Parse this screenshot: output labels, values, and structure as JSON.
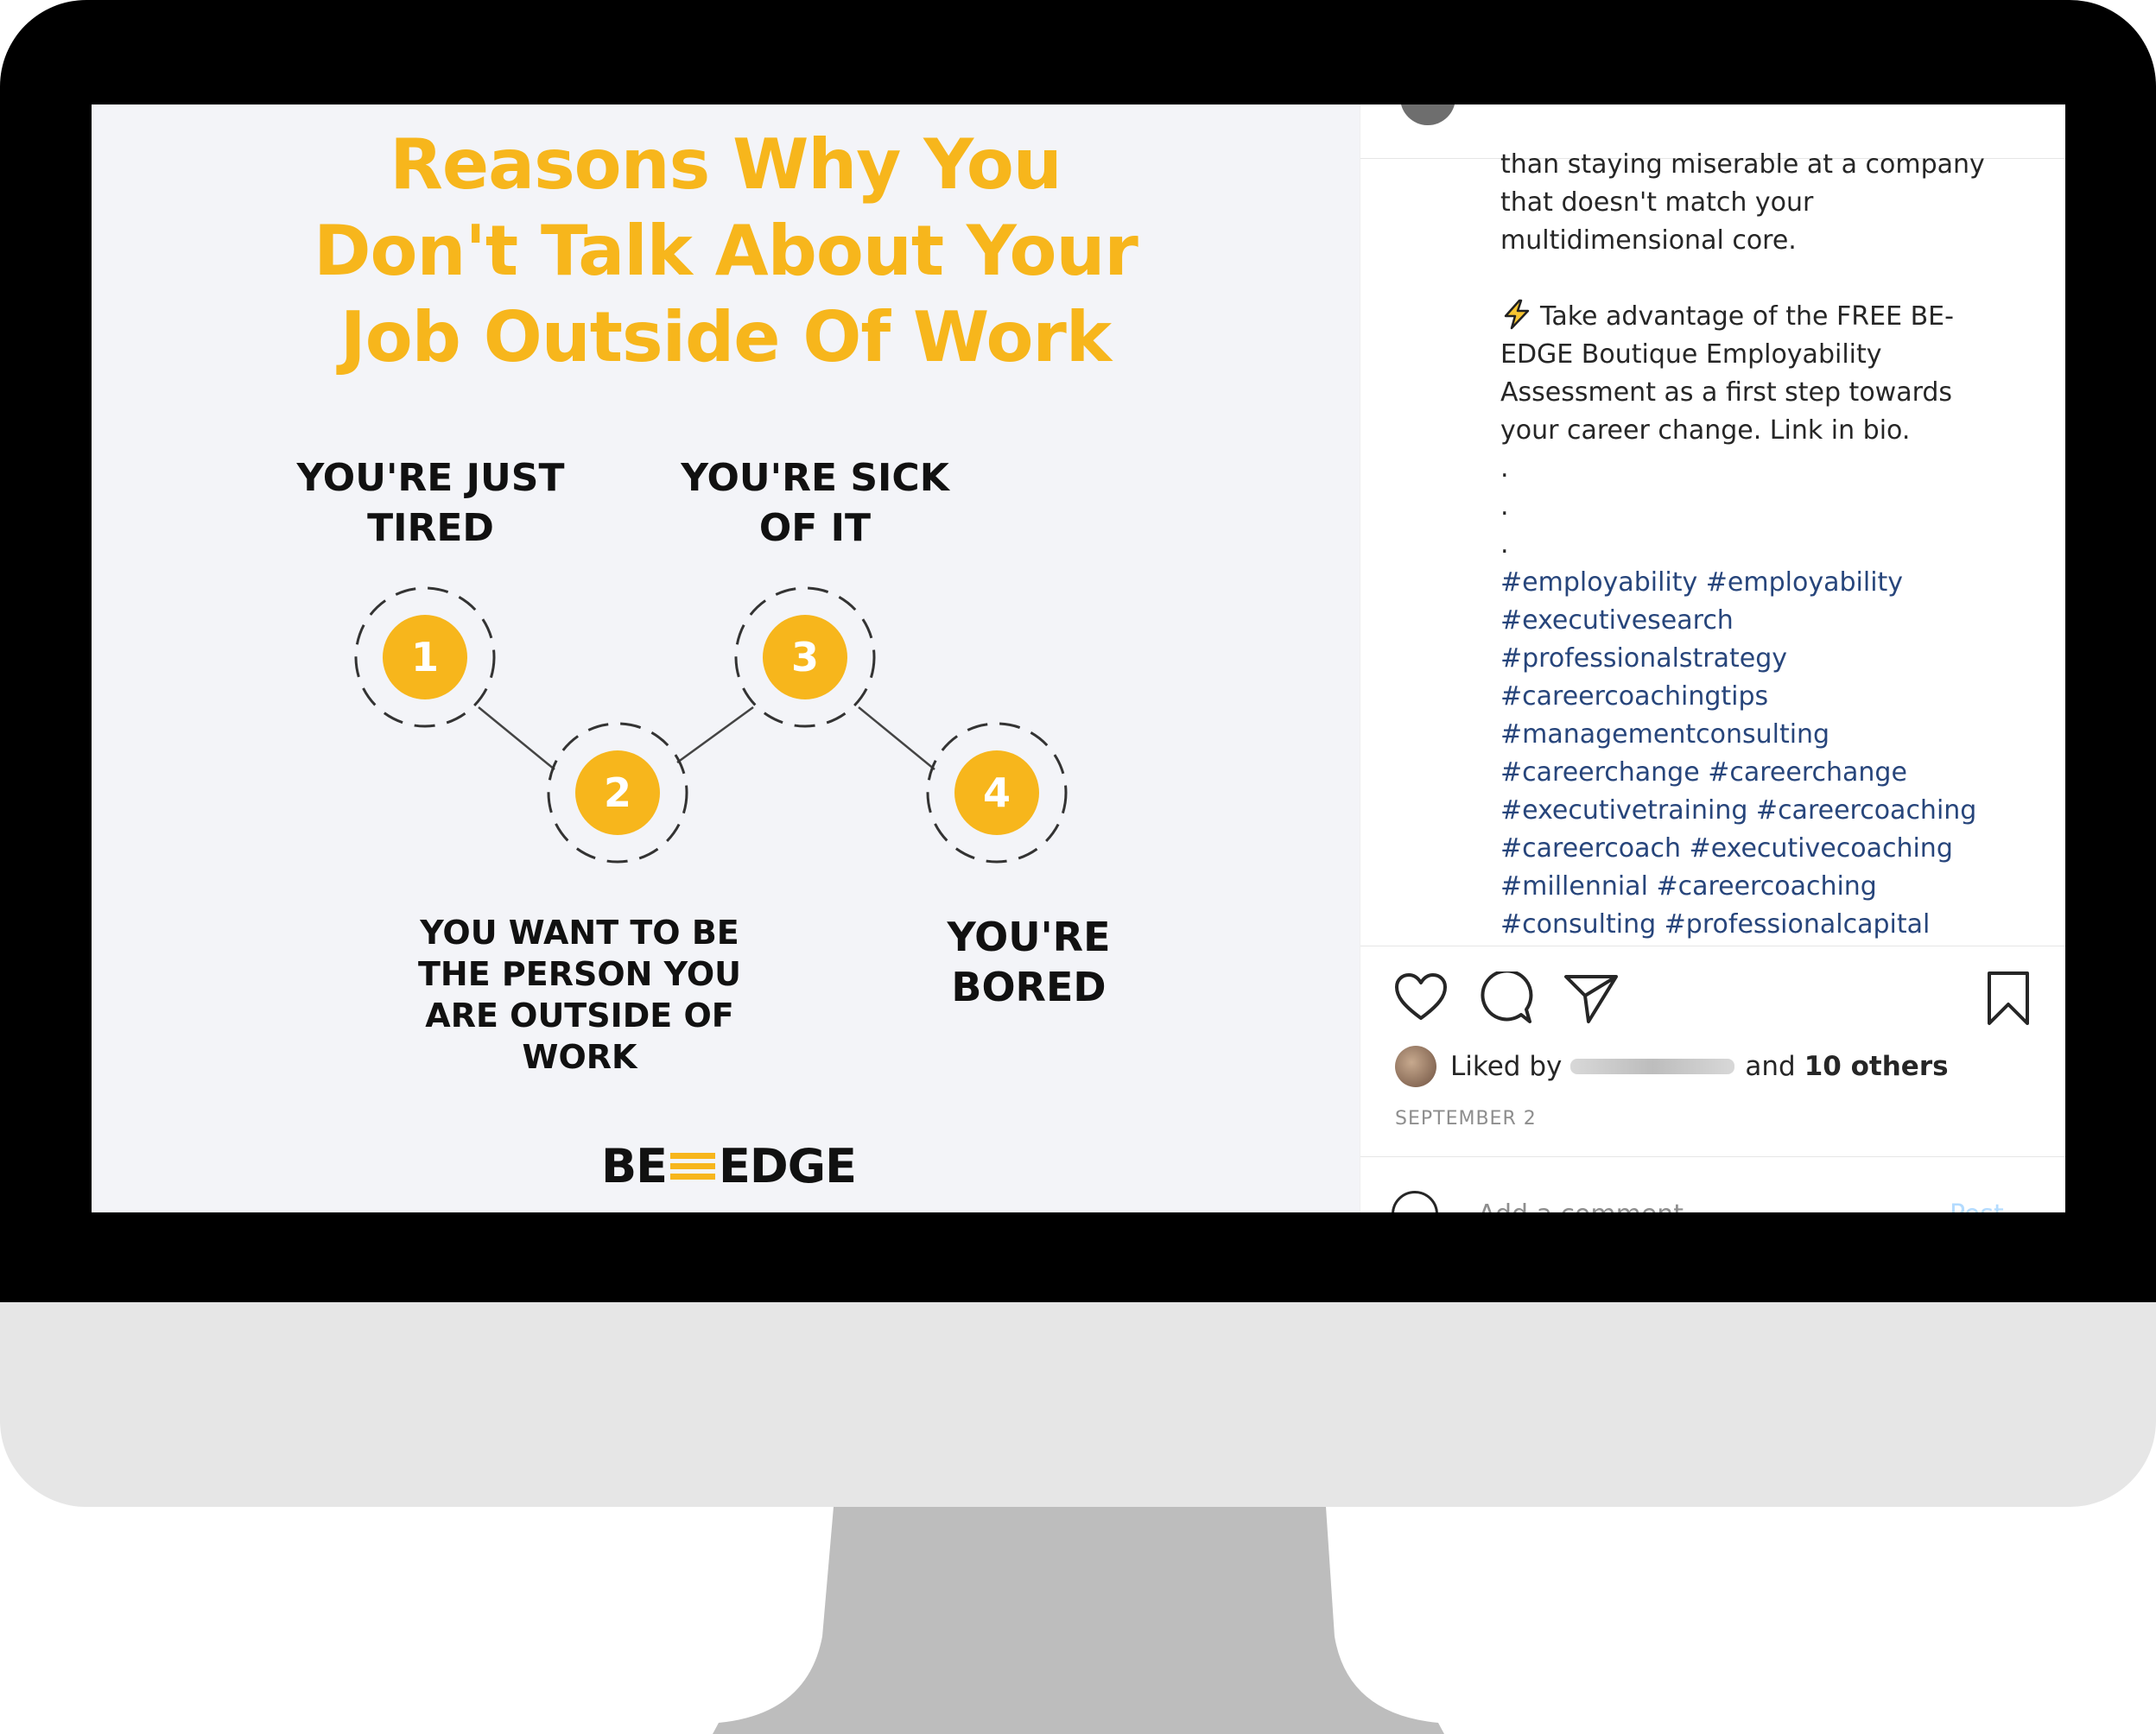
{
  "post_image": {
    "title_lines": [
      "Reasons Why You",
      "Don't Talk About Your",
      "Job Outside Of Work"
    ],
    "steps": [
      {
        "number": "1",
        "label": "YOU'RE JUST TIRED"
      },
      {
        "number": "2",
        "label": "YOU WANT TO BE THE PERSON YOU ARE OUTSIDE OF WORK"
      },
      {
        "number": "3",
        "label": "YOU'RE SICK OF IT"
      },
      {
        "number": "4",
        "label": "YOU'RE BORED"
      }
    ],
    "brand_left": "BE",
    "brand_right": "EDGE",
    "accent_color": "#f7b61c"
  },
  "caption": {
    "lines": [
      "than staying miserable at a company",
      "that doesn't match your",
      "multidimensional core.",
      "",
      "Take advantage of the FREE BE-",
      "EDGE Boutique Employability",
      "Assessment as a first step towards",
      "your career change. Link in bio.",
      ".",
      ".",
      "."
    ],
    "lightning_icon": "lightning-bolt-icon",
    "hashtag_lines": [
      "#employability #employability",
      "#executivesearch",
      "#professionalstrategy",
      "#careercoachingtips",
      "#managementconsulting",
      "#careerchange #careerchange",
      "#executivetraining #careercoaching",
      "#careercoach #executivecoaching",
      "#millennial #careercoaching",
      "#consulting #professionalcapital"
    ],
    "hashtag_color": "#27457b"
  },
  "actions": {
    "icons": [
      "heart-icon",
      "comment-icon",
      "share-icon",
      "bookmark-icon"
    ]
  },
  "likes": {
    "prefix": "Liked by",
    "and_text": "and",
    "others": "10 others"
  },
  "date": "SEPTEMBER 2",
  "comment": {
    "placeholder": "Add a comment...",
    "post_label": "Post"
  }
}
